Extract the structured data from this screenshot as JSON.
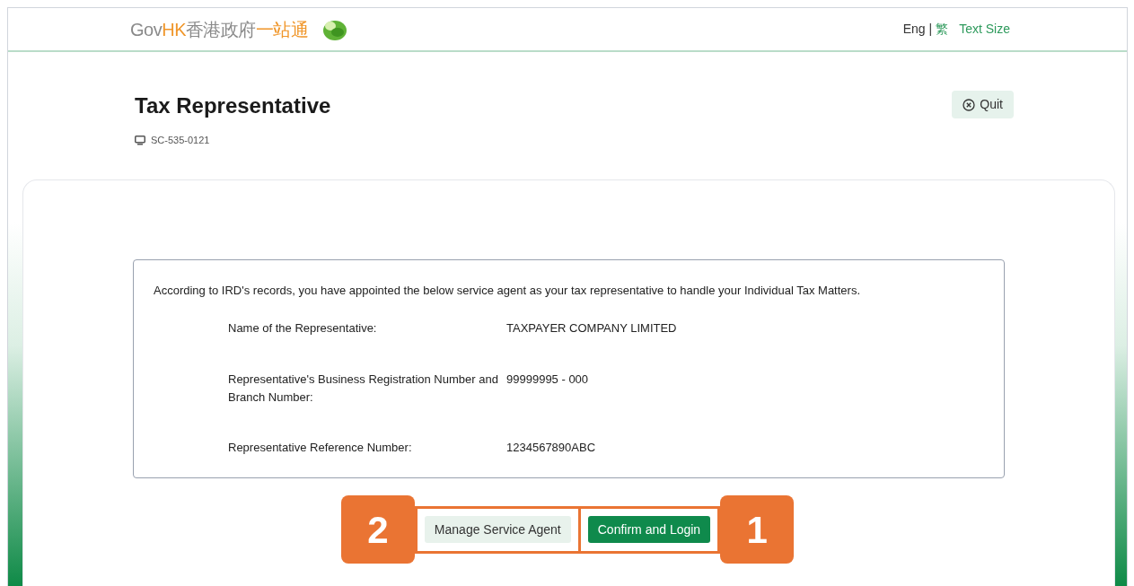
{
  "header": {
    "logo": {
      "parts": [
        {
          "text": "Gov",
          "kind": "plain"
        },
        {
          "text": "HK",
          "kind": "accent"
        },
        {
          "text": "香港政府",
          "kind": "plain"
        },
        {
          "text": "一站通",
          "kind": "accent"
        }
      ]
    },
    "links": [
      {
        "text": "Eng",
        "kind": "plain"
      },
      {
        "text": "|",
        "kind": "separator"
      },
      {
        "text": "繁",
        "kind": "link"
      },
      {
        "text": "Text Size",
        "kind": "link"
      }
    ]
  },
  "page": {
    "title": "Tax Representative",
    "screen_code": "SC-535-0121",
    "quit_button": "Quit"
  },
  "notice": {
    "intro": "According to IRD's records, you have appointed the below service agent as your tax representative to handle your Individual Tax Matters.",
    "rows": [
      {
        "label": "Name of the Representative:",
        "value": "TAXPAYER COMPANY LIMITED"
      },
      {
        "label": "Representative's Business Registration Number and Branch Number:",
        "value": "99999995 - 000"
      },
      {
        "label": "Representative Reference Number:",
        "value": "1234567890ABC"
      }
    ]
  },
  "actions": [
    {
      "label": "Manage Service Agent",
      "kind": "secondary",
      "callout": "2"
    },
    {
      "label": "Confirm and Login",
      "kind": "primary",
      "callout": "1"
    }
  ]
}
